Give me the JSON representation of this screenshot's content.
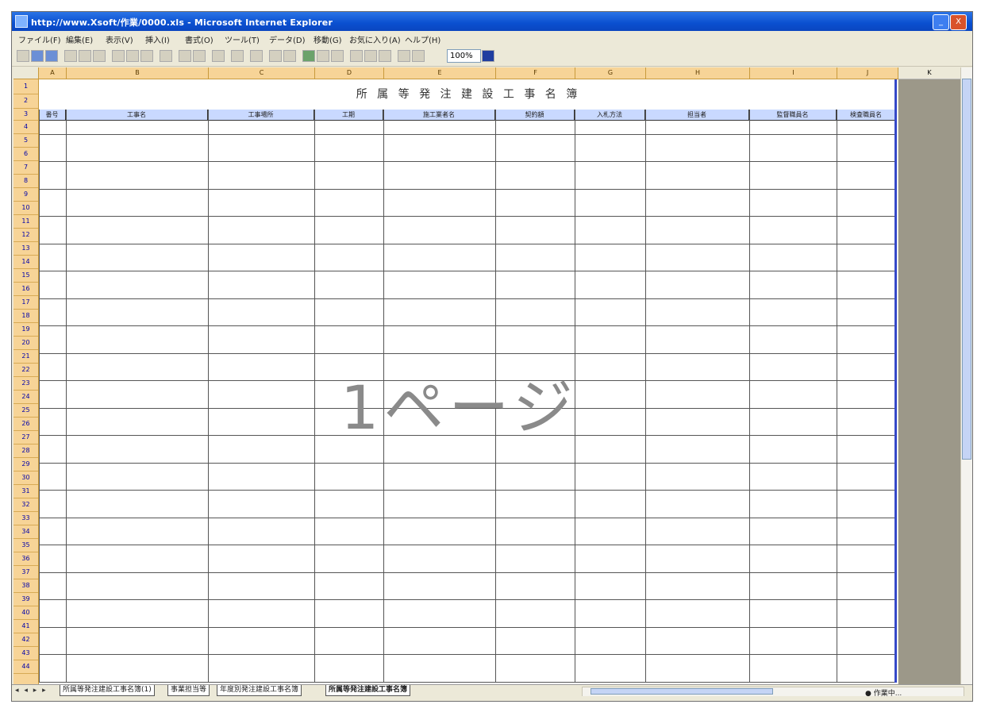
{
  "window": {
    "title": "http://www.Xsoft/作業/0000.xls - Microsoft Internet Explorer",
    "minimize_label": "_",
    "close_label": "X"
  },
  "menu": {
    "items": [
      "ファイル(F)",
      "編集(E)",
      "表示(V)",
      "挿入(I)",
      "書式(O)",
      "ツール(T)",
      "データ(D)",
      "移動(G)",
      "お気に入り(A)",
      "ヘルプ(H)"
    ]
  },
  "toolbar": {
    "zoom_value": "100%"
  },
  "columns": {
    "letters": [
      "A",
      "B",
      "C",
      "D",
      "E",
      "F",
      "G",
      "H",
      "I",
      "J"
    ],
    "extra_letter": "K"
  },
  "rows": {
    "numbers": [
      "1",
      "2",
      "3",
      "4",
      "5",
      "6",
      "7",
      "8",
      "9",
      "10",
      "11",
      "12",
      "13",
      "14",
      "15",
      "16",
      "17",
      "18",
      "19",
      "20",
      "21",
      "22",
      "23",
      "24",
      "25",
      "26",
      "27",
      "28",
      "29",
      "30",
      "31",
      "32",
      "33",
      "34",
      "35",
      "36",
      "37",
      "38",
      "39",
      "40",
      "41",
      "42",
      "43",
      "44"
    ]
  },
  "sheet": {
    "title": "所 属 等 発 注 建 設 工 事 名 簿",
    "headers": [
      "番号",
      "工事名",
      "工事場所",
      "工期",
      "施工業者名",
      "契約額",
      "入札方法",
      "担当者",
      "監督職員名",
      "検査職員名"
    ],
    "watermark": "1ページ"
  },
  "tabs": {
    "nav": "◂ ◂ ▸ ▸",
    "items": [
      "所属等発注建設工事名簿(1)",
      "事業担当等",
      "年度別発注建設工事名簿",
      "所属等発注建設工事名簿"
    ]
  },
  "status": {
    "label": "● 作業中..."
  }
}
